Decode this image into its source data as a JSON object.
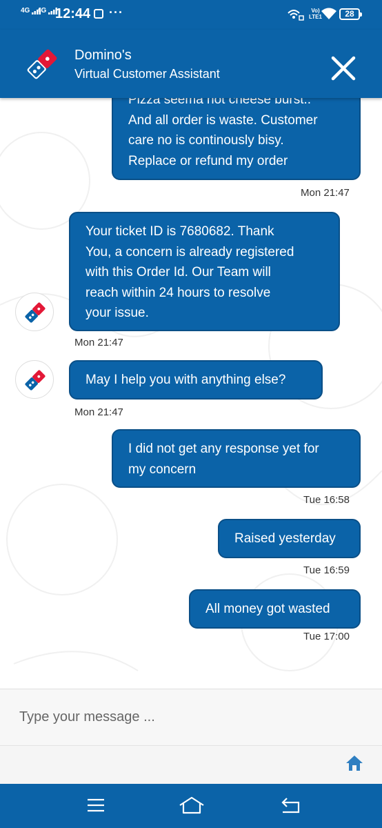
{
  "status_bar": {
    "signal_1": "4G",
    "signal_2": "4G",
    "time": "12:44",
    "volte_line1": "Vo)",
    "volte_line2": "LTE1",
    "battery": "28",
    "icons": [
      "signal-icon",
      "signal-icon",
      "image-notification-icon",
      "more-dots-icon",
      "hotspot-icon",
      "volte-icon",
      "wifi-icon",
      "battery-icon"
    ]
  },
  "header": {
    "title": "Domino's",
    "subtitle": "Virtual Customer Assistant",
    "icons": [
      "dominos-logo-icon",
      "close-icon"
    ]
  },
  "messages": [
    {
      "sender": "user",
      "lines": [
        "Pizza seema not cheese burst..",
        "And all order is waste. Customer",
        "care no is continously bisy.",
        "Replace or refund my order"
      ],
      "time": "Mon 21:47"
    },
    {
      "sender": "bot",
      "lines": [
        "Your ticket ID is 7680682. Thank",
        "You, a concern is already registered",
        "with this Order Id. Our Team will",
        "reach within 24 hours to resolve",
        "your issue."
      ],
      "time": "Mon 21:47"
    },
    {
      "sender": "bot",
      "lines": [
        "May I help you with anything else?"
      ],
      "time": "Mon 21:47"
    },
    {
      "sender": "user",
      "lines": [
        "I did not get any response yet for",
        "my concern"
      ],
      "time": "Tue 16:58"
    },
    {
      "sender": "user",
      "lines": [
        "Raised yesterday"
      ],
      "time": "Tue 16:59"
    },
    {
      "sender": "user",
      "lines": [
        "All money got wasted"
      ],
      "time": "Tue 17:00"
    }
  ],
  "composer": {
    "placeholder": "Type your message ...",
    "icons": [
      "home-icon"
    ]
  },
  "nav_bar": {
    "icons": [
      "menu-icon",
      "home-nav-icon",
      "back-icon"
    ]
  },
  "colors": {
    "brand_blue": "#0b63a8",
    "dominos_red": "#e31837",
    "bubble_border": "#0a4f87"
  }
}
